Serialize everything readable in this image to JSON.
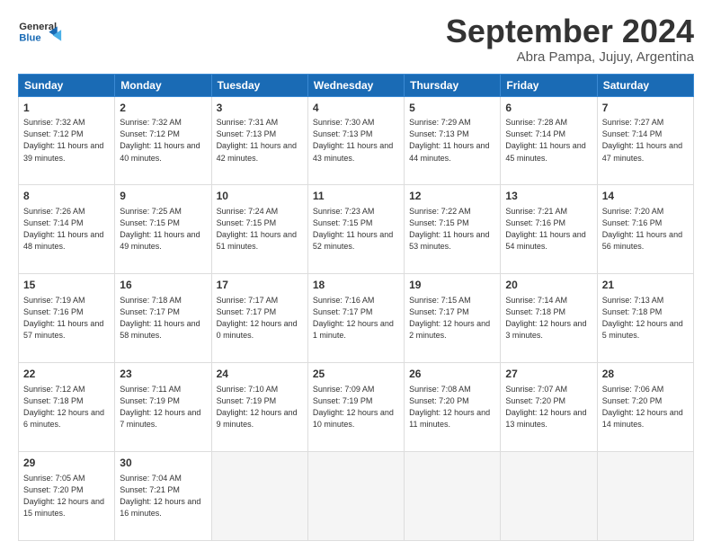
{
  "logo": {
    "general": "General",
    "blue": "Blue"
  },
  "title": "September 2024",
  "subtitle": "Abra Pampa, Jujuy, Argentina",
  "headers": [
    "Sunday",
    "Monday",
    "Tuesday",
    "Wednesday",
    "Thursday",
    "Friday",
    "Saturday"
  ],
  "weeks": [
    [
      {
        "day": "1",
        "sunrise": "7:32 AM",
        "sunset": "7:12 PM",
        "daylight": "11 hours and 39 minutes."
      },
      {
        "day": "2",
        "sunrise": "7:32 AM",
        "sunset": "7:12 PM",
        "daylight": "11 hours and 40 minutes."
      },
      {
        "day": "3",
        "sunrise": "7:31 AM",
        "sunset": "7:13 PM",
        "daylight": "11 hours and 42 minutes."
      },
      {
        "day": "4",
        "sunrise": "7:30 AM",
        "sunset": "7:13 PM",
        "daylight": "11 hours and 43 minutes."
      },
      {
        "day": "5",
        "sunrise": "7:29 AM",
        "sunset": "7:13 PM",
        "daylight": "11 hours and 44 minutes."
      },
      {
        "day": "6",
        "sunrise": "7:28 AM",
        "sunset": "7:14 PM",
        "daylight": "11 hours and 45 minutes."
      },
      {
        "day": "7",
        "sunrise": "7:27 AM",
        "sunset": "7:14 PM",
        "daylight": "11 hours and 47 minutes."
      }
    ],
    [
      {
        "day": "8",
        "sunrise": "7:26 AM",
        "sunset": "7:14 PM",
        "daylight": "11 hours and 48 minutes."
      },
      {
        "day": "9",
        "sunrise": "7:25 AM",
        "sunset": "7:15 PM",
        "daylight": "11 hours and 49 minutes."
      },
      {
        "day": "10",
        "sunrise": "7:24 AM",
        "sunset": "7:15 PM",
        "daylight": "11 hours and 51 minutes."
      },
      {
        "day": "11",
        "sunrise": "7:23 AM",
        "sunset": "7:15 PM",
        "daylight": "11 hours and 52 minutes."
      },
      {
        "day": "12",
        "sunrise": "7:22 AM",
        "sunset": "7:15 PM",
        "daylight": "11 hours and 53 minutes."
      },
      {
        "day": "13",
        "sunrise": "7:21 AM",
        "sunset": "7:16 PM",
        "daylight": "11 hours and 54 minutes."
      },
      {
        "day": "14",
        "sunrise": "7:20 AM",
        "sunset": "7:16 PM",
        "daylight": "11 hours and 56 minutes."
      }
    ],
    [
      {
        "day": "15",
        "sunrise": "7:19 AM",
        "sunset": "7:16 PM",
        "daylight": "11 hours and 57 minutes."
      },
      {
        "day": "16",
        "sunrise": "7:18 AM",
        "sunset": "7:17 PM",
        "daylight": "11 hours and 58 minutes."
      },
      {
        "day": "17",
        "sunrise": "7:17 AM",
        "sunset": "7:17 PM",
        "daylight": "12 hours and 0 minutes."
      },
      {
        "day": "18",
        "sunrise": "7:16 AM",
        "sunset": "7:17 PM",
        "daylight": "12 hours and 1 minute."
      },
      {
        "day": "19",
        "sunrise": "7:15 AM",
        "sunset": "7:17 PM",
        "daylight": "12 hours and 2 minutes."
      },
      {
        "day": "20",
        "sunrise": "7:14 AM",
        "sunset": "7:18 PM",
        "daylight": "12 hours and 3 minutes."
      },
      {
        "day": "21",
        "sunrise": "7:13 AM",
        "sunset": "7:18 PM",
        "daylight": "12 hours and 5 minutes."
      }
    ],
    [
      {
        "day": "22",
        "sunrise": "7:12 AM",
        "sunset": "7:18 PM",
        "daylight": "12 hours and 6 minutes."
      },
      {
        "day": "23",
        "sunrise": "7:11 AM",
        "sunset": "7:19 PM",
        "daylight": "12 hours and 7 minutes."
      },
      {
        "day": "24",
        "sunrise": "7:10 AM",
        "sunset": "7:19 PM",
        "daylight": "12 hours and 9 minutes."
      },
      {
        "day": "25",
        "sunrise": "7:09 AM",
        "sunset": "7:19 PM",
        "daylight": "12 hours and 10 minutes."
      },
      {
        "day": "26",
        "sunrise": "7:08 AM",
        "sunset": "7:20 PM",
        "daylight": "12 hours and 11 minutes."
      },
      {
        "day": "27",
        "sunrise": "7:07 AM",
        "sunset": "7:20 PM",
        "daylight": "12 hours and 13 minutes."
      },
      {
        "day": "28",
        "sunrise": "7:06 AM",
        "sunset": "7:20 PM",
        "daylight": "12 hours and 14 minutes."
      }
    ],
    [
      {
        "day": "29",
        "sunrise": "7:05 AM",
        "sunset": "7:20 PM",
        "daylight": "12 hours and 15 minutes."
      },
      {
        "day": "30",
        "sunrise": "7:04 AM",
        "sunset": "7:21 PM",
        "daylight": "12 hours and 16 minutes."
      },
      null,
      null,
      null,
      null,
      null
    ]
  ]
}
